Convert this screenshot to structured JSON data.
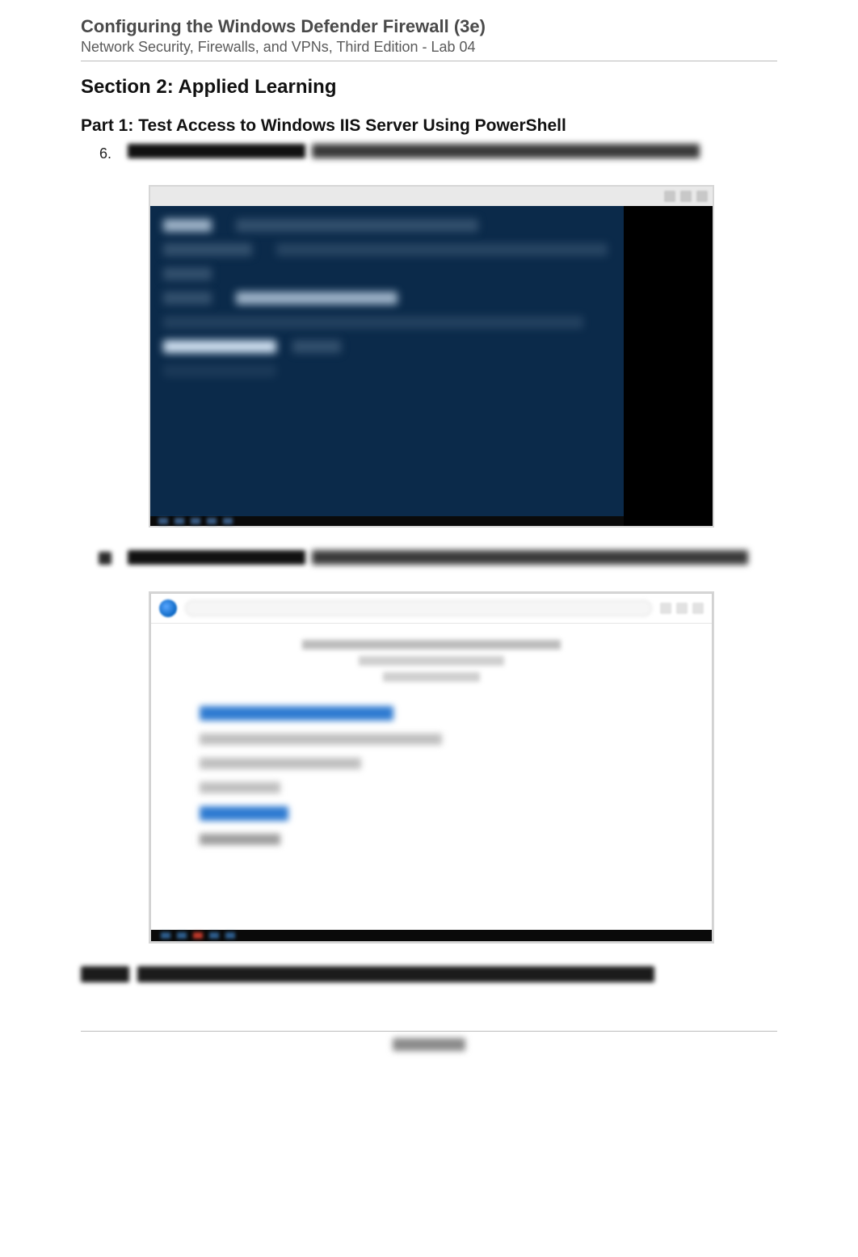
{
  "header": {
    "title": "Configuring the Windows Defender Firewall (3e)",
    "subtitle": "Network Security, Firewalls, and VPNs, Third Edition - Lab 04"
  },
  "section_title": "Section 2: Applied Learning",
  "part1_title": "Part 1: Test Access to Windows IIS Server Using PowerShell",
  "list": {
    "item6_number": "6."
  }
}
